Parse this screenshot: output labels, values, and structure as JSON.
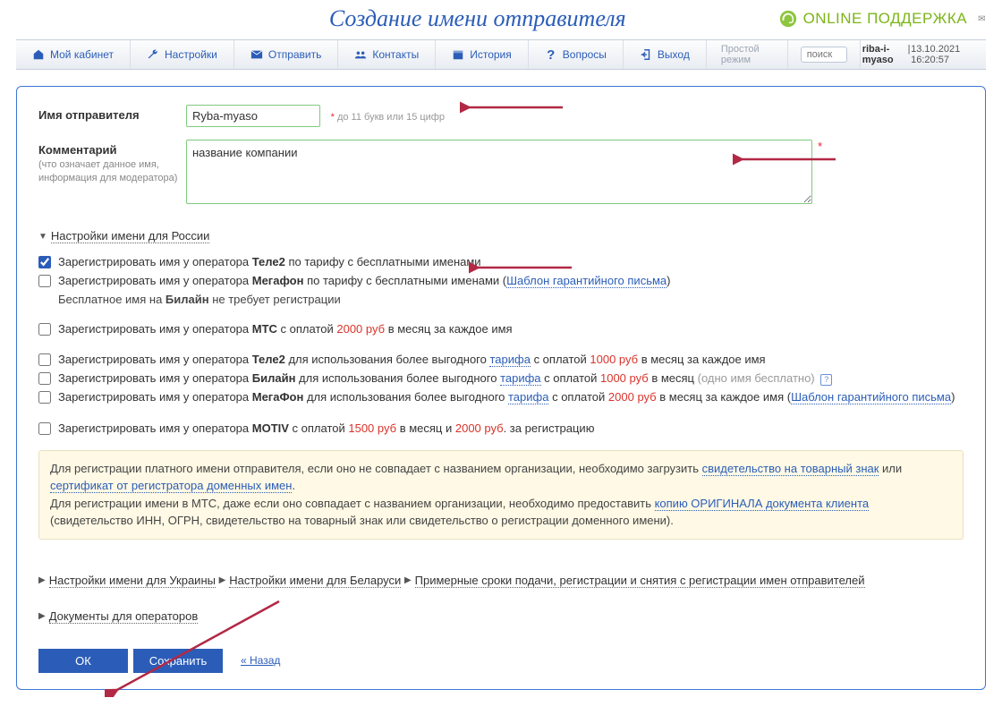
{
  "header": {
    "page_title": "Создание имени отправителя",
    "support_label": "ONLINE ПОДДЕРЖКА"
  },
  "nav": {
    "items": [
      {
        "label": "Мой кабинет",
        "icon": "home"
      },
      {
        "label": "Настройки",
        "icon": "wrench"
      },
      {
        "label": "Отправить",
        "icon": "envelope"
      },
      {
        "label": "Контакты",
        "icon": "contacts"
      },
      {
        "label": "История",
        "icon": "calendar"
      },
      {
        "label": "Вопросы",
        "icon": "question"
      },
      {
        "label": "Выход",
        "icon": "exit"
      }
    ],
    "mode_label": "Простой режим",
    "search_placeholder": "поиск",
    "user": "riba-i-myaso",
    "timestamp": "13.10.2021 16:20:57"
  },
  "form": {
    "sender_name": {
      "label": "Имя отправителя",
      "value": "Ryba-myaso",
      "hint": "до 11 букв или 15 цифр"
    },
    "comment": {
      "label": "Комментарий",
      "sub": "(что означает данное имя, информация для модератора)",
      "value": "название компании"
    }
  },
  "sections": {
    "russia": {
      "title": "Настройки имени для России",
      "lines": {
        "tele2_free": {
          "checked": true,
          "pre": "Зарегистрировать имя у оператора ",
          "op": "Теле2",
          "post": " по тарифу с бесплатными именами"
        },
        "megafon_free": {
          "checked": false,
          "pre": "Зарегистрировать имя у оператора ",
          "op": "Мегафон",
          "post1": " по тарифу с бесплатными именами (",
          "link": "Шаблон гарантийного письма",
          "post2": ")"
        },
        "beeline_note": {
          "pre": "Бесплатное имя на ",
          "op": "Билайн",
          "post": " не требует регистрации"
        },
        "mts_paid": {
          "checked": false,
          "pre": "Зарегистрировать имя у оператора ",
          "op": "МТС",
          "post1": " с оплатой ",
          "price": "2000 руб",
          "post2": " в месяц за каждое имя"
        },
        "tele2_paid": {
          "checked": false,
          "pre": "Зарегистрировать имя у оператора ",
          "op": "Теле2",
          "mid1": " для использования более выгодного ",
          "link": "тарифа",
          "mid2": " с оплатой ",
          "price": "1000 руб",
          "post": " в месяц за каждое имя"
        },
        "beeline_paid": {
          "checked": false,
          "pre": "Зарегистрировать имя у оператора ",
          "op": "Билайн",
          "mid1": " для использования более выгодного ",
          "link": "тарифа",
          "mid2": " с оплатой ",
          "price": "1000 руб",
          "post1": " в месяц ",
          "note": "(одно имя бесплатно)"
        },
        "megafon_paid": {
          "checked": false,
          "pre": "Зарегистрировать имя у оператора ",
          "op": "МегаФон",
          "mid1": " для использования более выгодного ",
          "link": "тарифа",
          "mid2": " с оплатой ",
          "price": "2000 руб",
          "post1": " в месяц за каждое имя (",
          "link2": "Шаблон гарантийного письма",
          "post2": ")"
        },
        "motiv": {
          "checked": false,
          "pre": "Зарегистрировать имя у оператора ",
          "op": "MOTIV",
          "mid1": " с оплатой ",
          "price1": "1500 руб",
          "mid2": " в месяц и ",
          "price2": "2000 руб",
          "post": ". за регистрацию"
        }
      },
      "info": {
        "p1a": "Для регистрации платного имени отправителя, если оно не совпадает с названием организации, необходимо загрузить ",
        "link1": "свидетельство на товарный знак",
        "p1b": " или ",
        "link2": "сертификат от регистратора доменных имен",
        "p1c": ".",
        "p2a": "Для регистрации имени в МТС, даже если оно совпадает с названием организации, необходимо предоставить ",
        "link3": "копию ОРИГИНАЛА документа клиента",
        "p2b": " (свидетельство ИНН, ОГРН, свидетельство на товарный знак или свидетельство о регистрации доменного имени)."
      }
    },
    "collapsed": [
      "Настройки имени для Украины",
      "Настройки имени для Беларуси",
      "Примерные сроки подачи, регистрации и снятия с регистрации имен отправителей",
      "Документы для операторов"
    ]
  },
  "buttons": {
    "ok": "ОК",
    "save": "Сохранить",
    "back": "« Назад"
  }
}
